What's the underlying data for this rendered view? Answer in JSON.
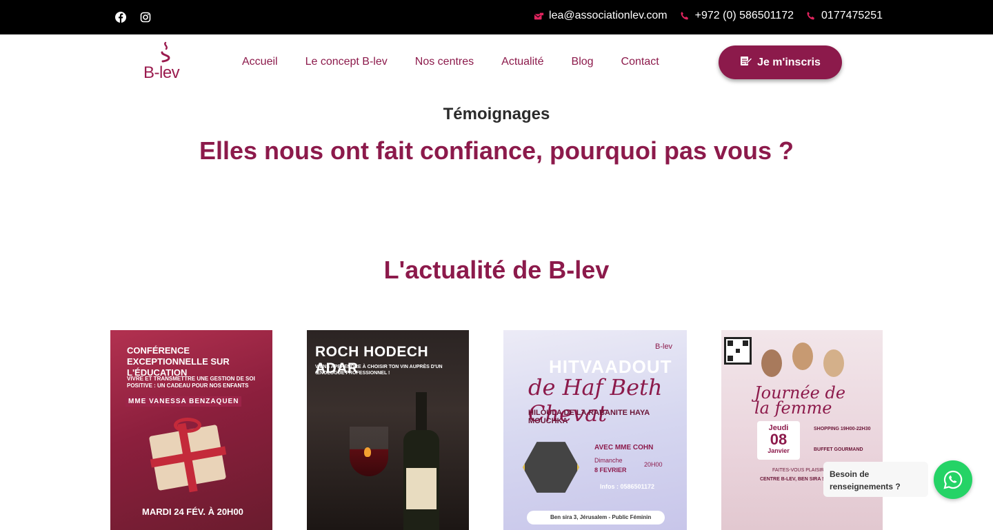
{
  "topbar": {
    "email": "lea@associationlev.com",
    "phone1": "+972 (0) 586501172",
    "phone2": "0177475251"
  },
  "header": {
    "logo_text": "B-lev",
    "nav": [
      "Accueil",
      "Le concept B-lev",
      "Nos centres",
      "Actualité",
      "Blog",
      "Contact"
    ],
    "cta_label": "Je m'inscris"
  },
  "testimonials": {
    "title": "Témoignages",
    "subtitle": "Elles nous ont fait confiance, pourquoi pas vous ?"
  },
  "news": {
    "title": "L'actualité de B-lev",
    "cards": [
      {
        "headline": "CONFÉRENCE EXCEPTIONNELLE SUR L'ÉDUCATION",
        "subline": "VIVRE ET TRANSMETTRE UNE GESTION DE SOI POSITIVE : UN CADEAU POUR NOS ENFANTS",
        "speaker": "MME VANESSA BENZAQUEN",
        "date": "MARDI 24 FÉV. À 20H00"
      },
      {
        "headline": "ROCH HODECH ADAR",
        "subline": "VIENS APPRENDRE À CHOISIR TON VIN AUPRÈS D'UN ŒNOLOGUE PROFESSIONNEL !"
      },
      {
        "headline": "HITVAADOUT",
        "handwritten": "de Haf Beth Chevat",
        "subline": "HILOULA DE LA RABANITE HAYA MOUCHKA",
        "brand": "B-lev",
        "speaker": "AVEC MME COHN",
        "day": "Dimanche",
        "date": "8 FEVRIER",
        "time": "20H00",
        "info": "Infos : 0586501172",
        "address": "Ben sira 3, Jérusalem - Public Féminin"
      },
      {
        "title": "Journée de la femme",
        "day_name": "Jeudi",
        "day_num": "08",
        "month": "Janvier",
        "shopping": "SHOPPING 19H00-22H30",
        "buffet": "BUFFET GOURMAND",
        "tagline": "FAITES-VOUS PLAISIR POUR L",
        "location": "CENTRE B-LEV, BEN SIRA ST 3"
      }
    ]
  },
  "chat": {
    "bubble_text": "Besoin de renseignements ?"
  },
  "colors": {
    "brand": "#8c1a4b",
    "topbar": "#000000",
    "whatsapp": "#25d366"
  }
}
